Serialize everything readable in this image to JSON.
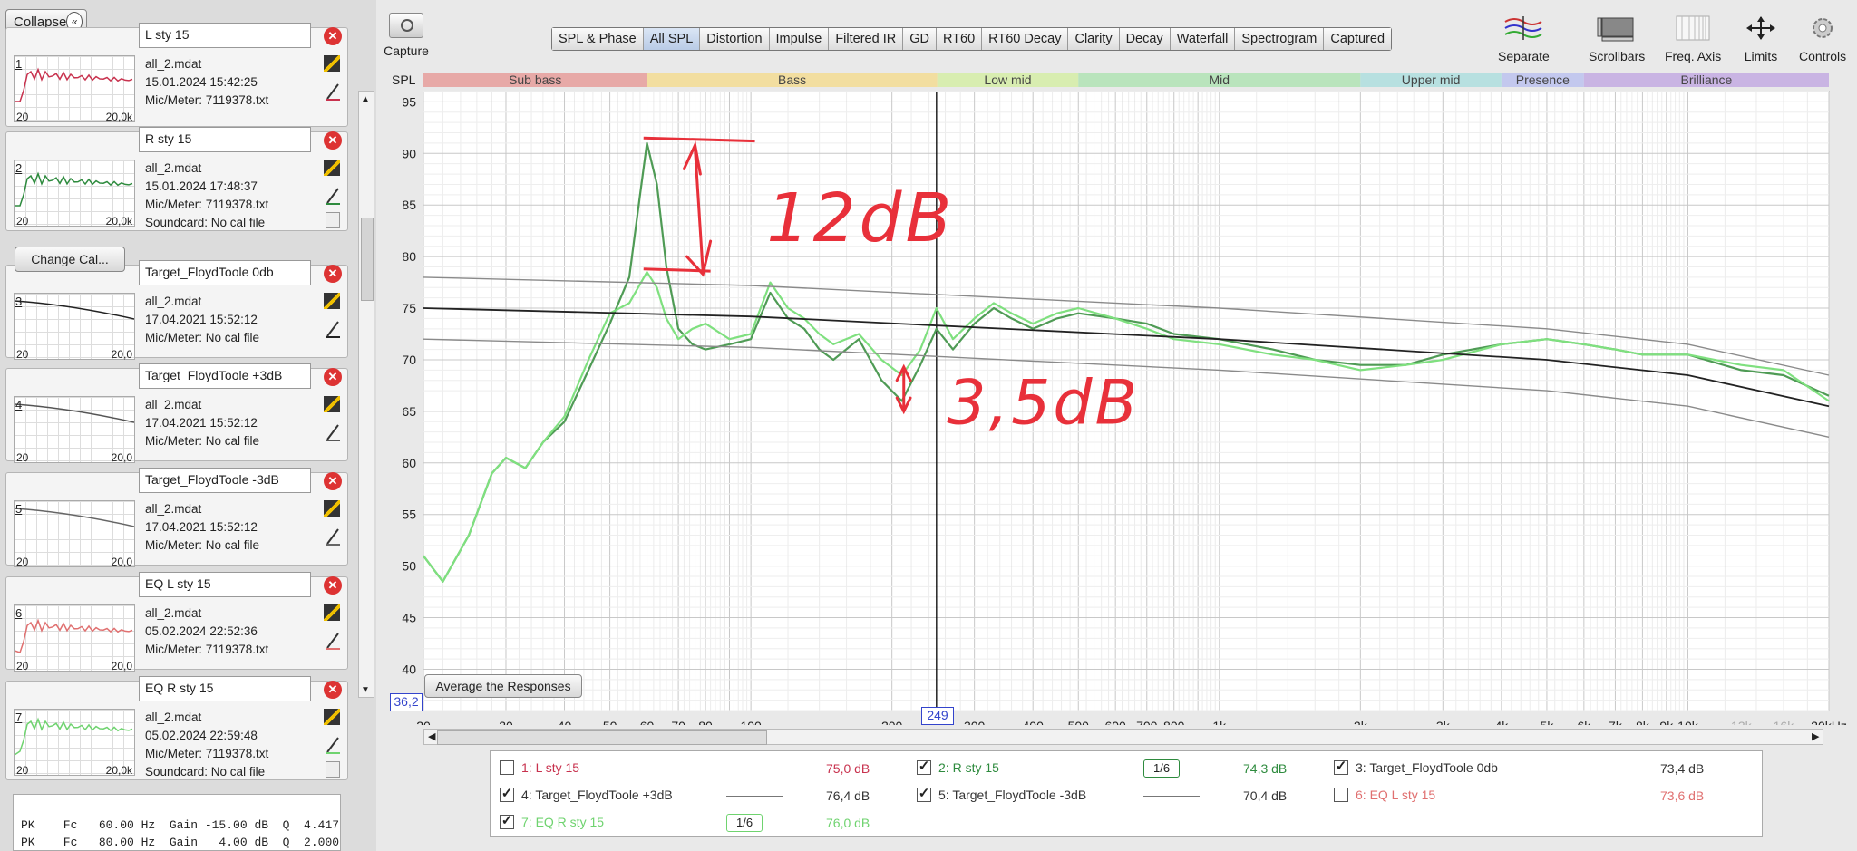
{
  "left_panel": {
    "collapse_label": "Collapse",
    "change_cal_label": "Change Cal...",
    "measurements": [
      {
        "index": "1",
        "name": "L sty 15",
        "file": "all_2.mdat",
        "date": "15.01.2024 15:42:25",
        "mic": "Mic/Meter: 7119378.txt",
        "extra": "",
        "color": "#c8324e",
        "x_min": "20",
        "x_max": "20,0k"
      },
      {
        "index": "2",
        "name": "R sty 15",
        "file": "all_2.mdat",
        "date": "15.01.2024 17:48:37",
        "mic": "Mic/Meter: 7119378.txt",
        "extra": "Soundcard: No cal file",
        "color": "#2e8b3e",
        "x_min": "20",
        "x_max": "20,0k"
      },
      {
        "index": "3",
        "name": "Target_FloydToole 0db",
        "file": "all_2.mdat",
        "date": "17.04.2021 15:52:12",
        "mic": "Mic/Meter: No cal file",
        "extra": "",
        "color": "#222222",
        "x_min": "20",
        "x_max": "20,0"
      },
      {
        "index": "4",
        "name": "Target_FloydToole +3dB",
        "file": "all_2.mdat",
        "date": "17.04.2021 15:52:12",
        "mic": "Mic/Meter: No cal file",
        "extra": "",
        "color": "#555555",
        "x_min": "20",
        "x_max": "20,0"
      },
      {
        "index": "5",
        "name": "Target_FloydToole -3dB",
        "file": "all_2.mdat",
        "date": "17.04.2021 15:52:12",
        "mic": "Mic/Meter: No cal file",
        "extra": "",
        "color": "#666666",
        "x_min": "20",
        "x_max": "20,0"
      },
      {
        "index": "6",
        "name": "EQ L sty 15",
        "file": "all_2.mdat",
        "date": "05.02.2024 22:52:36",
        "mic": "Mic/Meter: 7119378.txt",
        "extra": "",
        "color": "#e07070",
        "x_min": "20",
        "x_max": "20,0"
      },
      {
        "index": "7",
        "name": "EQ R sty 15",
        "file": "all_2.mdat",
        "date": "05.02.2024 22:59:48",
        "mic": "Mic/Meter: 7119378.txt",
        "extra": "Soundcard: No cal file",
        "color": "#6fd36f",
        "x_min": "20",
        "x_max": "20,0k"
      }
    ],
    "eq_filters": [
      "PK    Fc   60.00 Hz  Gain -15.00 dB  Q  4.417",
      "PK    Fc   80.00 Hz  Gain   4.00 dB  Q  2.000"
    ]
  },
  "toolbar": {
    "capture_label": "Capture",
    "tabs": [
      "SPL & Phase",
      "All SPL",
      "Distortion",
      "Impulse",
      "Filtered IR",
      "GD",
      "RT60",
      "RT60 Decay",
      "Clarity",
      "Decay",
      "Waterfall",
      "Spectrogram",
      "Captured"
    ],
    "active_tab": "All SPL",
    "tools": [
      {
        "label": "Separate",
        "icon": "separate-icon"
      },
      {
        "label": "Scrollbars",
        "icon": "scrollbars-icon"
      },
      {
        "label": "Freq. Axis",
        "icon": "freq-axis-icon"
      },
      {
        "label": "Limits",
        "icon": "limits-icon"
      },
      {
        "label": "Controls",
        "icon": "controls-icon"
      }
    ]
  },
  "chart_data": {
    "type": "line",
    "ylabel": "SPL",
    "xlabel": "",
    "y_ticks": [
      "95",
      "90",
      "85",
      "80",
      "75",
      "70",
      "65",
      "60",
      "55",
      "50",
      "45",
      "40"
    ],
    "x_ticks": [
      "20",
      "30",
      "40",
      "50",
      "60",
      "70",
      "80",
      "100",
      "200",
      "300",
      "400",
      "500",
      "600",
      "700",
      "800",
      "1k",
      "2k",
      "3k",
      "4k",
      "5k",
      "6k",
      "7k",
      "8k",
      "9k",
      "10k",
      "13k",
      "16k",
      "20kHz"
    ],
    "xlim": [
      20,
      20000
    ],
    "ylim": [
      36,
      96
    ],
    "x_scale": "log",
    "bands": [
      {
        "name": "Sub bass",
        "from": 20,
        "to": 60,
        "color": "#e7a9a7"
      },
      {
        "name": "Bass",
        "from": 60,
        "to": 250,
        "color": "#f2dea0"
      },
      {
        "name": "Low mid",
        "from": 250,
        "to": 500,
        "color": "#d8edb0"
      },
      {
        "name": "Mid",
        "from": 500,
        "to": 2000,
        "color": "#b9e4bc"
      },
      {
        "name": "Upper mid",
        "from": 2000,
        "to": 4000,
        "color": "#b7e0e0"
      },
      {
        "name": "Presence",
        "from": 4000,
        "to": 6000,
        "color": "#c3c8ee"
      },
      {
        "name": "Brilliance",
        "from": 6000,
        "to": 20000,
        "color": "#c9b4e3"
      }
    ],
    "series": [
      {
        "name": "R sty 15",
        "color": "#4f9b55",
        "x": [
          20,
          22,
          25,
          28,
          30,
          33,
          36,
          40,
          45,
          50,
          55,
          58,
          60,
          63,
          66,
          70,
          75,
          80,
          90,
          100,
          110,
          120,
          130,
          140,
          150,
          170,
          190,
          210,
          230,
          249,
          270,
          300,
          330,
          360,
          400,
          450,
          500,
          600,
          700,
          800,
          1000,
          1300,
          1600,
          2000,
          2500,
          3000,
          4000,
          5000,
          6000,
          7000,
          8000,
          10000,
          13000,
          16000,
          20000
        ],
        "y": [
          51,
          48.5,
          53,
          59,
          60.5,
          59.5,
          62,
          64,
          69,
          73.5,
          78,
          86,
          91,
          87,
          79,
          73,
          71.5,
          71,
          71.5,
          72,
          76.5,
          74,
          73,
          71,
          70,
          72,
          68,
          66,
          69.5,
          73,
          71,
          73.5,
          75,
          74,
          73,
          74,
          74.5,
          74,
          73.5,
          72.5,
          72,
          71,
          70,
          69.5,
          69.5,
          70.5,
          71.5,
          72,
          71.5,
          71,
          70.5,
          70.5,
          69,
          68.5,
          66.5
        ]
      },
      {
        "name": "EQ R sty 15",
        "color": "#7fe07f",
        "x": [
          20,
          22,
          25,
          28,
          30,
          33,
          36,
          40,
          45,
          50,
          55,
          60,
          63,
          66,
          70,
          75,
          80,
          90,
          100,
          110,
          120,
          130,
          140,
          150,
          170,
          190,
          210,
          230,
          249,
          270,
          300,
          330,
          360,
          400,
          450,
          500,
          600,
          700,
          800,
          1000,
          1300,
          1600,
          2000,
          2500,
          3000,
          4000,
          5000,
          6000,
          7000,
          8000,
          10000,
          13000,
          16000,
          20000
        ],
        "y": [
          51,
          48.5,
          53,
          59,
          60.5,
          59.5,
          62,
          64.5,
          70,
          74.5,
          75.5,
          78.5,
          77,
          74,
          72,
          73,
          73.5,
          72,
          72.5,
          77.5,
          75,
          74,
          72.5,
          71.5,
          72.5,
          70,
          68.5,
          71,
          75,
          72,
          74,
          75.5,
          74.5,
          73.5,
          74.5,
          75,
          74,
          73,
          72,
          71.5,
          70.5,
          70,
          69,
          69.5,
          70,
          71.5,
          72,
          71.5,
          71,
          70.5,
          70.5,
          69.5,
          69,
          66
        ]
      },
      {
        "name": "Target_FloydToole 0db",
        "color": "#222222",
        "x": [
          20,
          100,
          1000,
          5000,
          10000,
          20000
        ],
        "y": [
          75,
          74.2,
          72,
          70,
          68.5,
          65.5
        ]
      },
      {
        "name": "Target_FloydToole +3dB",
        "color": "#8a8a8a",
        "x": [
          20,
          100,
          1000,
          5000,
          10000,
          20000
        ],
        "y": [
          78,
          77.2,
          75,
          73,
          71.5,
          68.5
        ]
      },
      {
        "name": "Target_FloydToole -3dB",
        "color": "#8a8a8a",
        "x": [
          20,
          100,
          1000,
          5000,
          10000,
          20000
        ],
        "y": [
          72,
          71.2,
          69,
          67,
          65.5,
          62.5
        ]
      }
    ],
    "annotations": [
      "12dB",
      "3,5dB"
    ],
    "cursor_x": 249
  },
  "chart_ui": {
    "average_label": "Average the Responses",
    "value_left": "36,2",
    "cursor_label": "249"
  },
  "legend": [
    {
      "label": "1: L sty 15",
      "value": "75,0 dB",
      "checked": false,
      "color": "#c8324e",
      "smoothing": ""
    },
    {
      "label": "2: R sty 15",
      "value": "74,3 dB",
      "checked": true,
      "color": "#2e8b3e",
      "smoothing": "1/6"
    },
    {
      "label": "3: Target_FloydToole 0db",
      "value": "73,4 dB",
      "checked": true,
      "color": "#222222",
      "smoothing": ""
    },
    {
      "label": "4: Target_FloydToole +3dB",
      "value": "76,4 dB",
      "checked": true,
      "color": "#555555",
      "smoothing": ""
    },
    {
      "label": "5: Target_FloydToole -3dB",
      "value": "70,4 dB",
      "checked": true,
      "color": "#555555",
      "smoothing": ""
    },
    {
      "label": "6: EQ L sty 15",
      "value": "73,6 dB",
      "checked": false,
      "color": "#e07070",
      "smoothing": ""
    },
    {
      "label": "7: EQ R sty 15",
      "value": "76,0 dB",
      "checked": true,
      "color": "#6fd36f",
      "smoothing": "1/6"
    }
  ]
}
